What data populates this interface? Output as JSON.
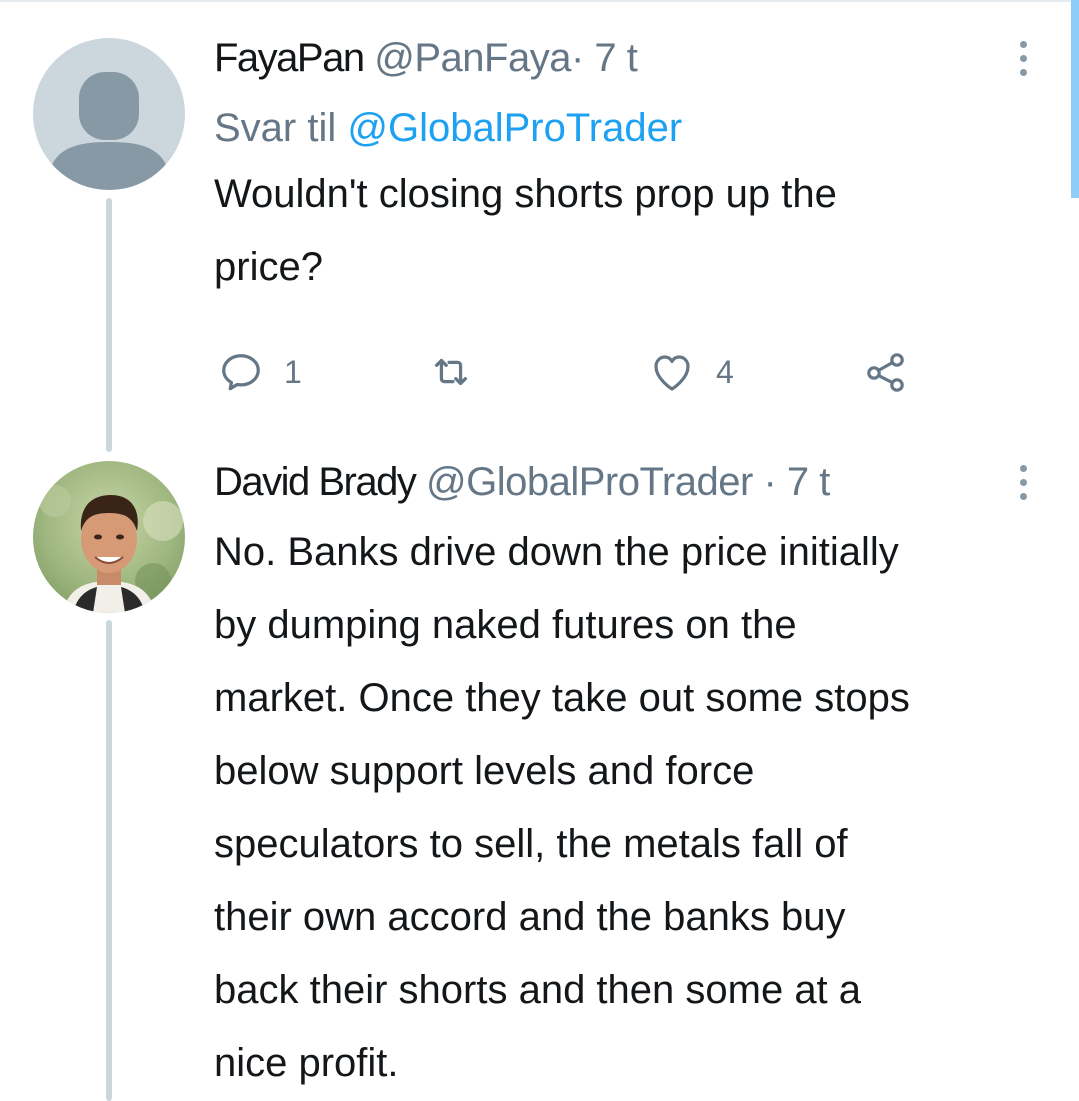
{
  "tweets": [
    {
      "display_name": "FayaPan",
      "handle": "@PanFaya",
      "separator": "·",
      "time": "7 t",
      "reply_prefix": "Svar til",
      "reply_to": "@GlobalProTrader",
      "text": "Wouldn't closing shorts prop up the\nprice?",
      "avatar_icon": "default-profile-icon",
      "actions": {
        "reply_icon": "reply-icon",
        "reply_count": "1",
        "retweet_icon": "retweet-icon",
        "like_icon": "heart-icon",
        "like_count": "4",
        "share_icon": "share-icon"
      }
    },
    {
      "display_name": "David Brady",
      "handle": "@GlobalProTrader",
      "separator": "·",
      "time": "7 t",
      "text": "No. Banks drive down the price initially\nby dumping naked futures on the\nmarket. Once they take out some stops\nbelow support levels and force\nspeculators to sell, the metals fall of\ntheir own accord and the banks buy\nback their shorts and then some at a\nnice profit.",
      "avatar_icon": "profile-photo"
    }
  ],
  "colors": {
    "text": "#14171a",
    "secondary": "#657786",
    "link": "#1da1f2",
    "thread_line": "#ccd6dd",
    "scroll_indicator": "#8ecdf8"
  }
}
